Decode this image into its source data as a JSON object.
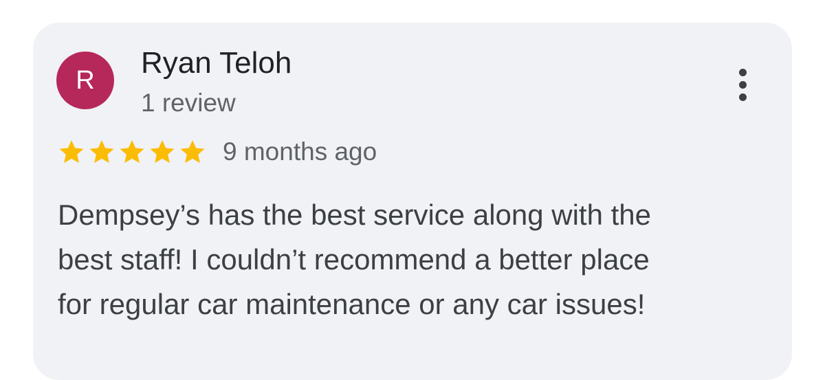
{
  "review": {
    "author": {
      "initial": "R",
      "name": "Ryan Teloh",
      "review_count": "1 review",
      "avatar_color": "#b6285a"
    },
    "rating": 5,
    "rating_max": 5,
    "star_color": "#fbbc04",
    "time_ago": "9 months ago",
    "text_lines": [
      "Dempsey’s has the best service along with the",
      "best staff! I couldn’t recommend a better place",
      "for regular car maintenance or any car issues!"
    ],
    "menu_icon": "more-vert-icon"
  }
}
